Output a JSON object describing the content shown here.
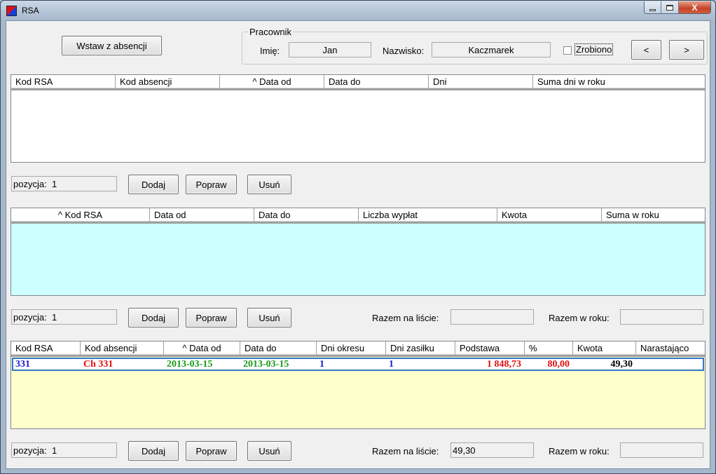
{
  "window": {
    "title": "RSA",
    "controls": {
      "minimize": "–",
      "close": "X"
    }
  },
  "toolbar": {
    "wstaw_label": "Wstaw z absencji"
  },
  "employee": {
    "group_title": "Pracownik",
    "first_name_label": "Imię:",
    "first_name": "Jan",
    "last_name_label": "Nazwisko:",
    "last_name": "Kaczmarek",
    "done_label": "Zrobiono",
    "done_checked": false,
    "prev_label": "<",
    "next_label": ">"
  },
  "grid1": {
    "columns": [
      "Kod RSA",
      "Kod absencji",
      "^ Data od",
      "Data do",
      "Dni",
      "Suma dni w roku"
    ],
    "rows": [],
    "position_label": "pozycja:",
    "position_value": "1",
    "buttons": {
      "add": "Dodaj",
      "edit": "Popraw",
      "delete": "Usuń"
    }
  },
  "grid2": {
    "columns": [
      "^ Kod RSA",
      "Data od",
      "Data do",
      "Liczba wypłat",
      "Kwota",
      "Suma w roku"
    ],
    "rows": [],
    "position_label": "pozycja:",
    "position_value": "1",
    "buttons": {
      "add": "Dodaj",
      "edit": "Popraw",
      "delete": "Usuń"
    },
    "total_list_label": "Razem na liście:",
    "total_list_value": "",
    "total_year_label": "Razem w roku:",
    "total_year_value": ""
  },
  "grid3": {
    "columns": [
      "Kod RSA",
      "Kod absencji",
      "^ Data od",
      "Data do",
      "Dni okresu",
      "Dni zasiłku",
      "Podstawa",
      "%",
      "Kwota",
      "Narastająco"
    ],
    "rows": [
      {
        "kod_rsa": "331",
        "kod_absencji": "Ch 331",
        "data_od": "2013-03-15",
        "data_do": "2013-03-15",
        "dni_okresu": "1",
        "dni_zasilku": "1",
        "podstawa": "1 848,73",
        "procent": "80,00",
        "kwota": "49,30",
        "narastajaco": ""
      }
    ],
    "position_label": "pozycja:",
    "position_value": "1",
    "buttons": {
      "add": "Dodaj",
      "edit": "Popraw",
      "delete": "Usuń"
    },
    "total_list_label": "Razem na liście:",
    "total_list_value": "49,30",
    "total_year_label": "Razem w roku:",
    "total_year_value": ""
  },
  "colors": {
    "grid2_background": "#ccffff",
    "grid3_background": "#ffffcc",
    "row_blue": "#1a1ad0",
    "row_red": "#e01010",
    "row_green": "#1a9a1a",
    "selection_border": "#3378c8"
  }
}
